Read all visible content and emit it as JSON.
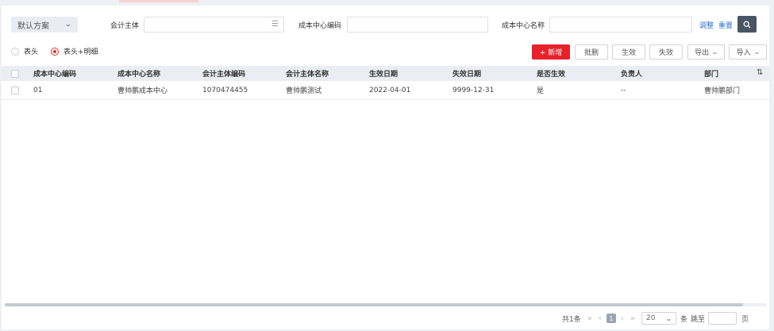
{
  "filter": {
    "scheme": "默认方案",
    "entity_label": "会计主体",
    "entity_value": "",
    "cost_code_label": "成本中心编码",
    "cost_code_value": "",
    "cost_name_label": "成本中心名称",
    "cost_name_value": "",
    "adjust_label": "调整",
    "reset_label": "重置",
    "icons": {
      "list": "list-icon",
      "search": "search-icon",
      "chevron": "chevron-down-icon"
    }
  },
  "toolbar": {
    "radio_header": "表头",
    "radio_header_detail": "表头+明细",
    "selected_radio": "表头+明细",
    "add_label": "+ 新增",
    "batch_delete_label": "批删",
    "activate_label": "生效",
    "deactivate_label": "失效",
    "export_label": "导出",
    "import_label": "导入",
    "primary_color": "#e8212b"
  },
  "table": {
    "columns": [
      "成本中心编码",
      "成本中心名称",
      "会计主体编码",
      "会计主体名称",
      "生效日期",
      "失效日期",
      "是否生效",
      "负责人",
      "部门"
    ],
    "rows": [
      [
        "01",
        "曹帅鹏成本中心",
        "1070474455",
        "曹帅鹏测试",
        "2022-04-01",
        "9999-12-31",
        "是",
        "--",
        "曹帅鹏部门"
      ]
    ],
    "settings_icon": "column-settings-icon"
  },
  "pager": {
    "total": "共1条",
    "first": "«",
    "prev": "‹",
    "current_page": "1",
    "next": "›",
    "last": "»",
    "page_size": "20",
    "per_page_unit": "条",
    "jump_label": "跳至",
    "page_unit": "页"
  }
}
